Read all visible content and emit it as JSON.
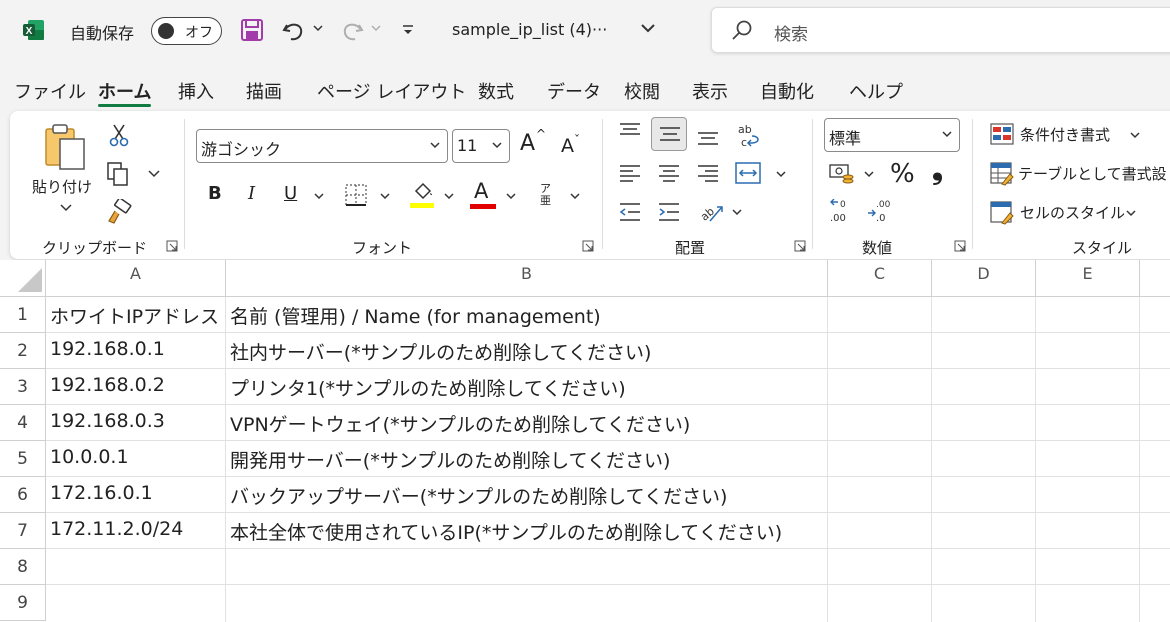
{
  "titlebar": {
    "autosave_label": "自動保存",
    "autosave_state": "オフ",
    "filename": "sample_ip_list (4)···",
    "search_placeholder": "検索"
  },
  "menu_tabs": [
    "ファイル",
    "ホーム",
    "挿入",
    "描画",
    "ページ レイアウト",
    "数式",
    "データ",
    "校閲",
    "表示",
    "自動化",
    "ヘルプ"
  ],
  "ribbon": {
    "clipboard": {
      "paste_label": "貼り付け",
      "group_label": "クリップボード"
    },
    "font": {
      "font_name": "游ゴシック",
      "font_size": "11",
      "bold": "B",
      "italic": "I",
      "underline": "U",
      "grow": "A",
      "shrink": "A",
      "font_color_glyph": "A",
      "phonetic": "ア亜",
      "group_label": "フォント"
    },
    "alignment": {
      "group_label": "配置"
    },
    "number": {
      "format": "標準",
      "percent": "%",
      "comma": "❟",
      "group_label": "数値"
    },
    "styles": {
      "conditional": "条件付き書式",
      "as_table": "テーブルとして書式設",
      "cell_styles": "セルのスタイル",
      "group_label": "スタイル"
    }
  },
  "sheet": {
    "columns": [
      "A",
      "B",
      "C",
      "D",
      "E"
    ],
    "rows": [
      "1",
      "2",
      "3",
      "4",
      "5",
      "6",
      "7",
      "8",
      "9"
    ],
    "data": [
      {
        "a": "ホワイトIPアドレス",
        "b": "名前 (管理用) / Name (for management)"
      },
      {
        "a": "192.168.0.1",
        "b": "社内サーバー(*サンプルのため削除してください)"
      },
      {
        "a": "192.168.0.2",
        "b": "プリンタ1(*サンプルのため削除してください)"
      },
      {
        "a": "192.168.0.3",
        "b": "VPNゲートウェイ(*サンプルのため削除してください)"
      },
      {
        "a": "10.0.0.1",
        "b": "開発用サーバー(*サンプルのため削除してください)"
      },
      {
        "a": "172.16.0.1",
        "b": "バックアップサーバー(*サンプルのため削除してください)"
      },
      {
        "a": "172.11.2.0/24",
        "b": "本社全体で使用されているIP(*サンプルのため削除してください)"
      }
    ]
  },
  "colors": {
    "excel_green": "#107c41",
    "highlight_yellow": "#ffff00",
    "font_red": "#e00000"
  }
}
